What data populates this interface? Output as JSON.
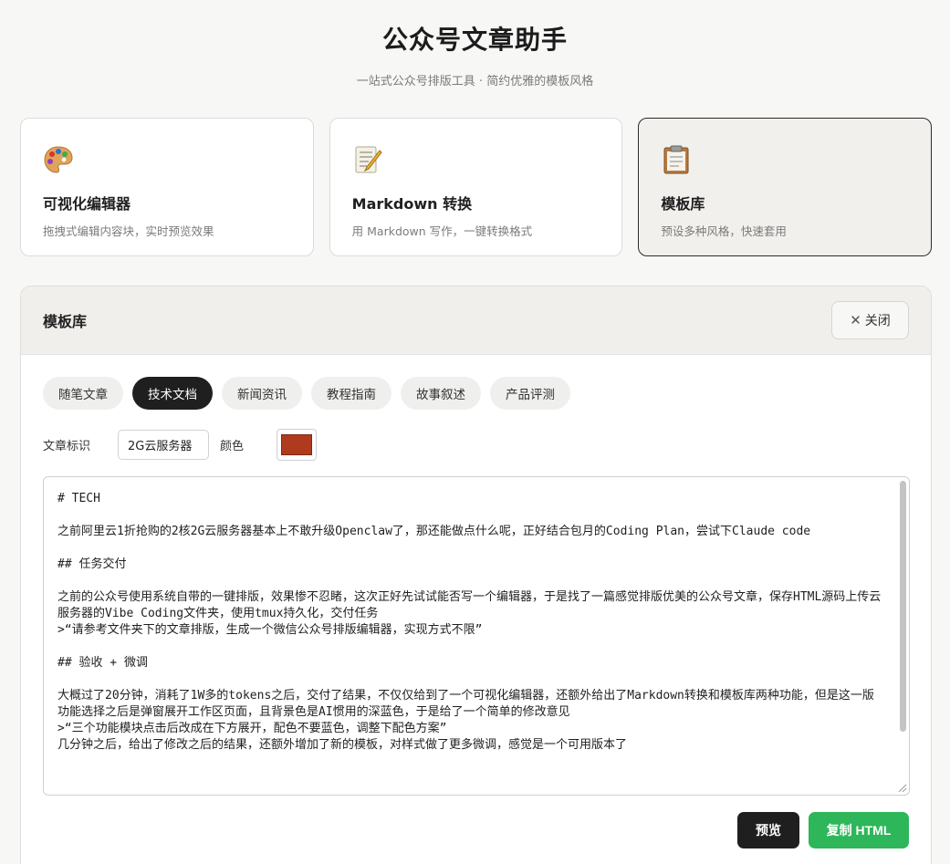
{
  "app": {
    "title": "公众号文章助手",
    "subtitle": "一站式公众号排版工具 · 简约优雅的模板风格"
  },
  "cards": [
    {
      "icon": "palette-icon",
      "title": "可视化编辑器",
      "desc": "拖拽式编辑内容块，实时预览效果"
    },
    {
      "icon": "memo-icon",
      "title": "Markdown 转换",
      "desc": "用 Markdown 写作，一键转换格式"
    },
    {
      "icon": "clipboard-icon",
      "title": "模板库",
      "desc": "预设多种风格，快速套用",
      "active": true
    }
  ],
  "panel": {
    "title": "模板库",
    "close_label": "关闭",
    "tabs": [
      {
        "label": "随笔文章"
      },
      {
        "label": "技术文档",
        "active": true
      },
      {
        "label": "新闻资讯"
      },
      {
        "label": "教程指南"
      },
      {
        "label": "故事叙述"
      },
      {
        "label": "产品评测"
      }
    ],
    "id_label": "文章标识",
    "id_value": "2G云服务器",
    "color_label": "颜色",
    "color_value": "#b03a1e",
    "editor_text": "# TECH\n\n之前阿里云1折抢购的2核2G云服务器基本上不敢升级Openclaw了，那还能做点什么呢，正好结合包月的Coding Plan，尝试下Claude code\n\n## 任务交付\n\n之前的公众号使用系统自带的一键排版，效果惨不忍睹，这次正好先试试能否写一个编辑器，于是找了一篇感觉排版优美的公众号文章，保存HTML源码上传云服务器的Vibe Coding文件夹，使用tmux持久化，交付任务\n>“请参考文件夹下的文章排版，生成一个微信公众号排版编辑器，实现方式不限”\n\n## 验收 + 微调\n\n大概过了20分钟，消耗了1W多的tokens之后，交付了结果，不仅仅给到了一个可视化编辑器，还额外给出了Markdown转换和模板库两种功能，但是这一版功能选择之后是弹窗展开工作区页面，且背景色是AI惯用的深蓝色，于是给了一个简单的修改意见\n>“三个功能模块点击后改成在下方展开，配色不要蓝色，调整下配色方案”\n几分钟之后，给出了修改之后的结果，还额外增加了新的模板，对样式做了更多微调，感觉是一个可用版本了",
    "preview_label": "预览",
    "copy_label": "复制 HTML"
  },
  "colors": {
    "accent_dark": "#1f1f1f",
    "copy_green": "#2eb65a",
    "active_card_bg": "#f1f0ed"
  }
}
